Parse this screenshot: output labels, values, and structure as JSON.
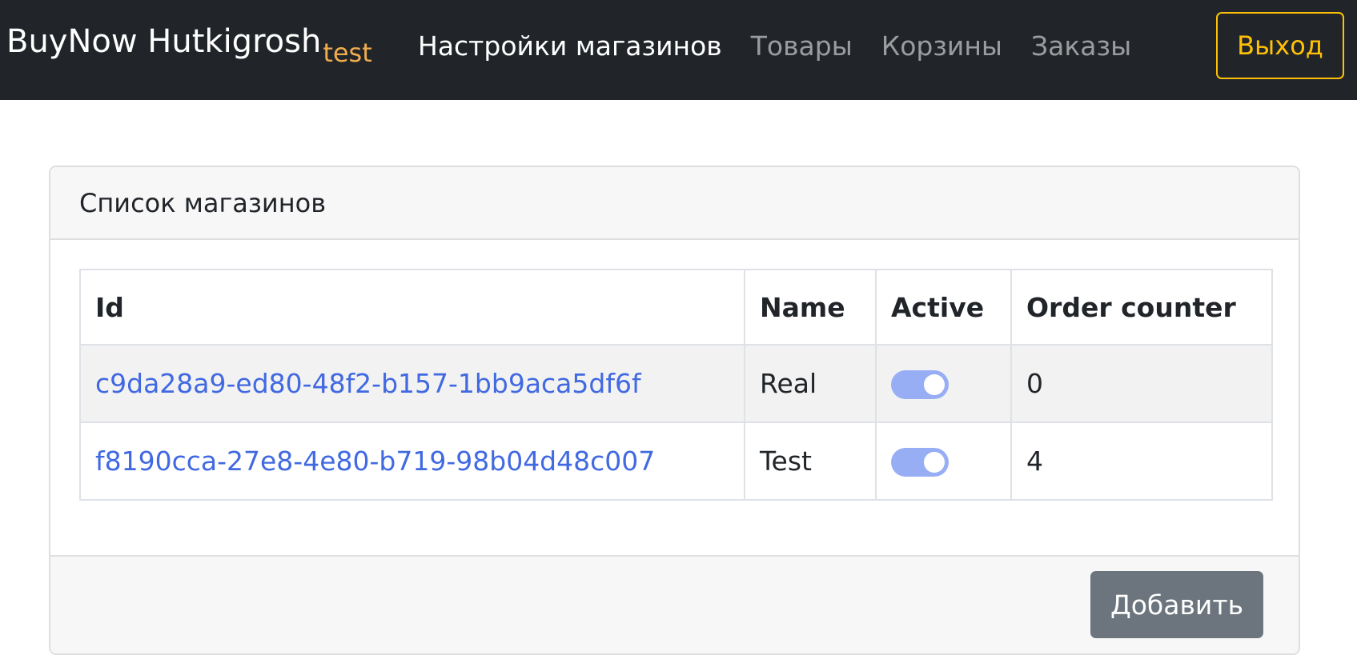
{
  "navbar": {
    "brand": "BuyNow Hutkigrosh",
    "brand_suffix": "test",
    "links": [
      {
        "label": "Настройки магазинов",
        "active": true
      },
      {
        "label": "Товары",
        "active": false
      },
      {
        "label": "Корзины",
        "active": false
      },
      {
        "label": "Заказы",
        "active": false
      }
    ],
    "logout_label": "Выход"
  },
  "card": {
    "header": "Список магазинов",
    "table": {
      "columns": [
        "Id",
        "Name",
        "Active",
        "Order counter"
      ],
      "rows": [
        {
          "id": "c9da28a9-ed80-48f2-b157-1bb9aca5df6f",
          "name": "Real",
          "active": true,
          "order_counter": "0"
        },
        {
          "id": "f8190cca-27e8-4e80-b719-98b04d48c007",
          "name": "Test",
          "active": true,
          "order_counter": "4"
        }
      ]
    },
    "add_label": "Добавить"
  },
  "colors": {
    "navbar_bg": "#212529",
    "brand_suffix": "#f0ad4e",
    "logout": "#ffc107",
    "link": "#4169e1",
    "toggle_on": "#97aef5",
    "add_button": "#6c757d"
  }
}
